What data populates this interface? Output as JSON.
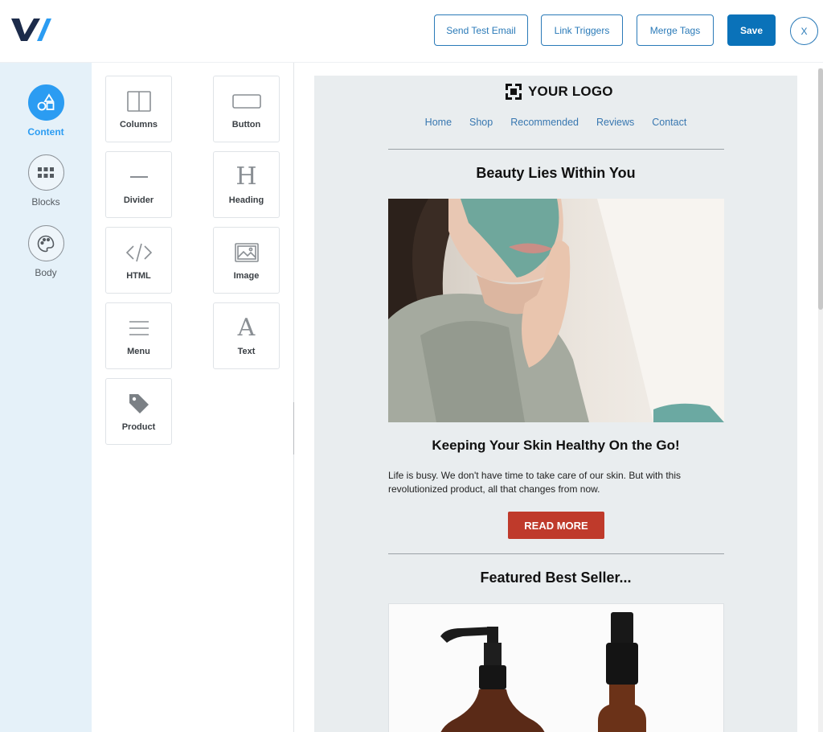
{
  "toolbar": {
    "send_test_email": "Send Test Email",
    "link_triggers": "Link Triggers",
    "merge_tags": "Merge Tags",
    "save": "Save",
    "close": "X"
  },
  "rail": {
    "items": [
      {
        "label": "Content",
        "icon": "shapes-icon",
        "active": true
      },
      {
        "label": "Blocks",
        "icon": "grid-icon",
        "active": false
      },
      {
        "label": "Body",
        "icon": "palette-icon",
        "active": false
      }
    ]
  },
  "tools": [
    {
      "label": "Columns",
      "icon": "columns-icon"
    },
    {
      "label": "Button",
      "icon": "button-icon"
    },
    {
      "label": "Divider",
      "icon": "divider-icon"
    },
    {
      "label": "Heading",
      "icon": "heading-icon"
    },
    {
      "label": "HTML",
      "icon": "code-icon"
    },
    {
      "label": "Image",
      "icon": "image-icon"
    },
    {
      "label": "Menu",
      "icon": "menu-icon"
    },
    {
      "label": "Text",
      "icon": "text-icon"
    },
    {
      "label": "Product",
      "icon": "tag-icon"
    }
  ],
  "email": {
    "logo_text": "YOUR LOGO",
    "nav": [
      "Home",
      "Shop",
      "Recommended",
      "Reviews",
      "Contact"
    ],
    "headline": "Beauty Lies Within You",
    "subheadline": "Keeping Your Skin Healthy On the Go!",
    "body_line_1": "Life is busy. We don't have time to take care of our skin. But with this",
    "body_line_2": "revolutionized product, all that changes from now.",
    "cta_label": "READ MORE",
    "featured_heading": "Featured Best Seller..."
  },
  "colors": {
    "accent": "#0a72b9",
    "rail_active": "#2b9cf2",
    "cta": "#bf3a2b",
    "email_bg": "#e9edef",
    "nav_link": "#3877b0"
  }
}
